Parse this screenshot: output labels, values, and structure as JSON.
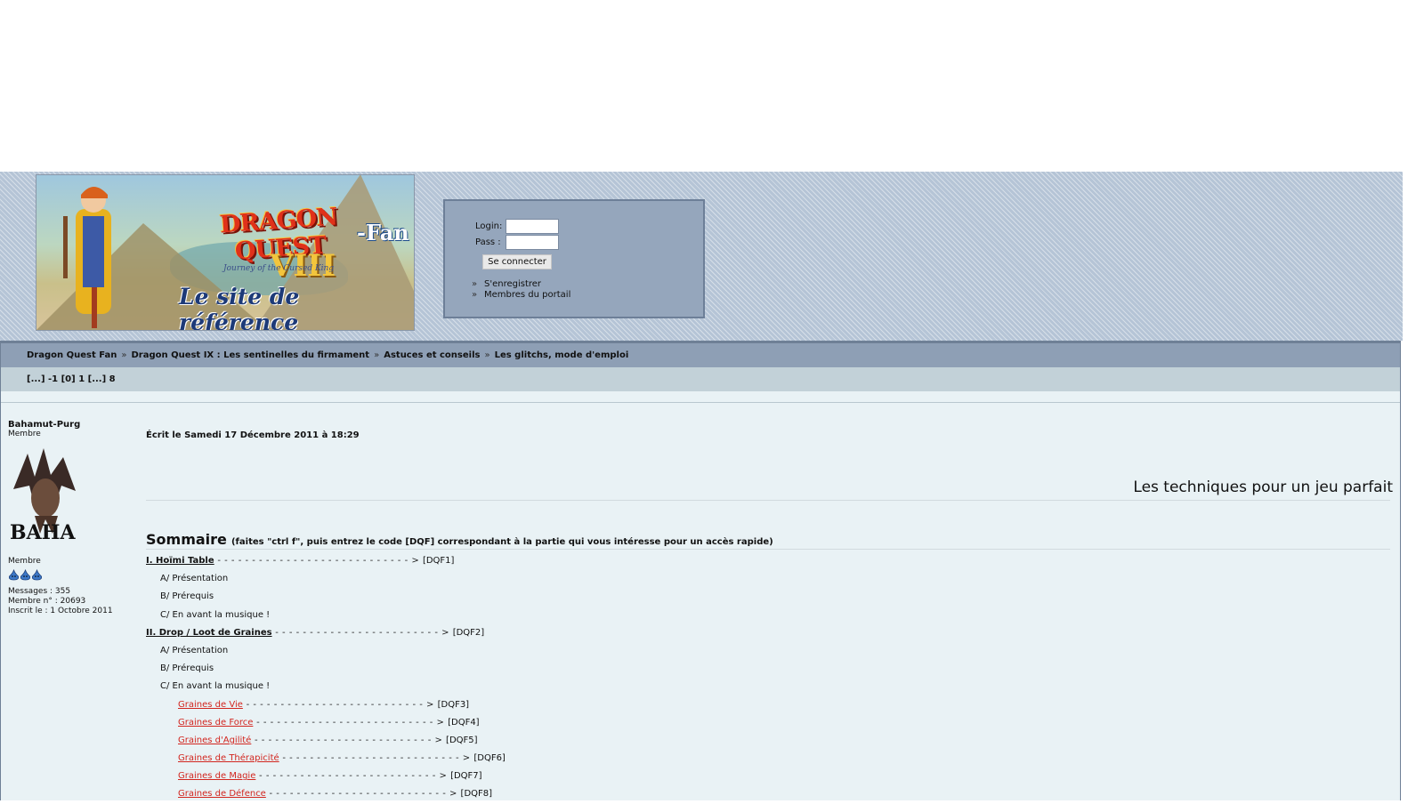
{
  "header": {
    "banner": {
      "logo_main": "DRAGON QUEST",
      "logo_fan": "-Fan",
      "logo_numeral": "VIII",
      "logo_subtitle": "Journey of the Cursed King",
      "tagline": "Le site de référence"
    },
    "login": {
      "login_label": "Login:",
      "pass_label": "Pass :",
      "submit_label": "Se connecter",
      "links": [
        {
          "label": "S'enregistrer"
        },
        {
          "label": "Membres du portail"
        }
      ]
    }
  },
  "breadcrumb": [
    {
      "label": "Dragon Quest Fan"
    },
    {
      "label": "Dragon Quest IX : Les sentinelles du firmament"
    },
    {
      "label": "Astuces et conseils"
    },
    {
      "label": "Les glitchs, mode d'emploi"
    }
  ],
  "breadcrumb_separator": "»",
  "pagination": "[...] -1 [0] 1 [...] 8",
  "author": {
    "name": "Bahamut-Purg",
    "role": "Membre",
    "avatar_text": "BAHA",
    "rank_label": "Membre",
    "rank_icon_count": 3,
    "messages": "Messages : 355",
    "member_number": "Membre n° : 20693",
    "joined": "Inscrit le : 1 Octobre 2011"
  },
  "post": {
    "date": "Écrit le Samedi 17 Décembre 2011 à 18:29",
    "heading": "Les techniques pour un jeu parfait",
    "summary_title": "Sommaire",
    "summary_note": "(faites \"ctrl f\", puis entrez le code [DQF] correspondant à la partie qui vous intéresse pour un accès rapide)",
    "toc": [
      {
        "type": "section",
        "label": "I. Hoïmi Table",
        "code": "[DQF1]"
      },
      {
        "type": "sub",
        "label": "A/ Présentation"
      },
      {
        "type": "sub",
        "label": "B/ Prérequis"
      },
      {
        "type": "sub",
        "label": "C/ En avant la musique !"
      },
      {
        "type": "section",
        "label": "II. Drop / Loot de Graines",
        "code": "[DQF2]"
      },
      {
        "type": "sub",
        "label": "A/ Présentation"
      },
      {
        "type": "sub",
        "label": "B/ Prérequis"
      },
      {
        "type": "sub",
        "label": "C/ En avant la musique !"
      },
      {
        "type": "seed",
        "label": "Graines de Vie",
        "code": "[DQF3]"
      },
      {
        "type": "seed",
        "label": "Graines de Force",
        "code": "[DQF4]"
      },
      {
        "type": "seed",
        "label": "Graines d'Agilité",
        "code": "[DQF5]"
      },
      {
        "type": "seed",
        "label": "Graines de Thérapicité",
        "code": "[DQF6]"
      },
      {
        "type": "seed",
        "label": "Graines de Magie",
        "code": "[DQF7]"
      },
      {
        "type": "seed",
        "label": "Graines de Défence",
        "code": "[DQF8]"
      }
    ]
  }
}
